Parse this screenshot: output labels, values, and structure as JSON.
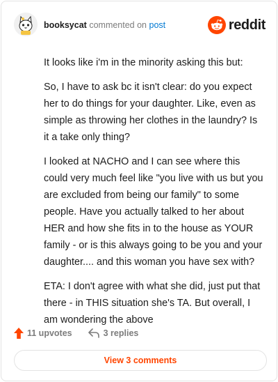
{
  "header": {
    "username": "booksycat",
    "action_text": "commented on",
    "post_link": "post",
    "brand": "reddit",
    "avatar_icon": "cat-avatar-icon",
    "brand_icon": "reddit-snoo-icon"
  },
  "comment": {
    "paragraphs": [
      "It looks like i'm in the minority asking this but:",
      "So, I have to ask bc it isn't clear: do you expect her to do things for your daughter. Like, even as simple as throwing her clothes in the laundry? Is it a take only thing?",
      "I looked at NACHO and I can see where this could very much feel like \"you live with us but you are excluded from being our family\" to some people. Have you actually talked to her about HER and how she fits in to the house as YOUR family - or is this always going to be you and your daughter.... and this woman you have sex with?",
      "ETA: I don't agree with what she did, just put that there - in THIS situation she's TA. But overall, I am wondering the above"
    ]
  },
  "actions": {
    "upvotes": "11 upvotes",
    "replies": "3 replies",
    "upvote_icon": "upvote-arrow-icon",
    "reply_icon": "reply-arrow-icon"
  },
  "view_button": {
    "label": "View 3 comments"
  },
  "colors": {
    "accent": "#ff4500",
    "link": "#0079d3",
    "muted": "#7c7c7c",
    "text": "#1c1c1c",
    "border": "#e3e3e3"
  }
}
